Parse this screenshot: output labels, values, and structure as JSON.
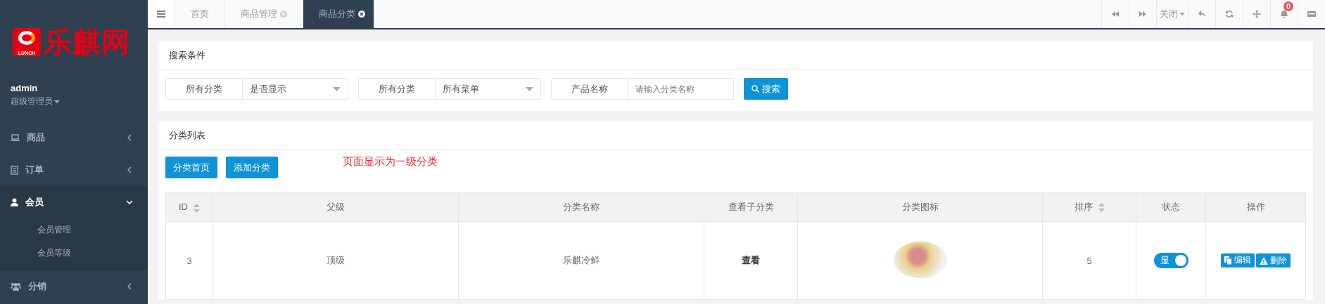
{
  "logo": {
    "mark_text": "LUNCH",
    "name": "乐麒网"
  },
  "user": {
    "name": "admin",
    "role": "超级管理员"
  },
  "sidebar": {
    "items": [
      {
        "label": "商品",
        "expanded": false
      },
      {
        "label": "订单",
        "expanded": false
      },
      {
        "label": "会员",
        "expanded": true,
        "children": [
          {
            "label": "会员管理"
          },
          {
            "label": "会员等级"
          }
        ]
      },
      {
        "label": "分销",
        "expanded": false
      }
    ]
  },
  "tabs": [
    {
      "label": "首页",
      "selected": false,
      "closable": false
    },
    {
      "label": "商品管理",
      "selected": false,
      "closable": true
    },
    {
      "label": "商品分类",
      "selected": true,
      "closable": true
    }
  ],
  "toolbar": {
    "close_menu": "关闭",
    "notifications": "0"
  },
  "search_card": {
    "title": "搜索条件",
    "filters": [
      {
        "kind": "select",
        "label": "所有分类",
        "value": "是否显示"
      },
      {
        "kind": "select",
        "label": "所有分类",
        "value": "所有菜单"
      },
      {
        "kind": "input",
        "label": "产品名称",
        "placeholder": "请输入分类名称"
      }
    ],
    "button": "搜索"
  },
  "list_card": {
    "title": "分类列表",
    "buttons": [
      "分类首页",
      "添加分类"
    ],
    "note": "页面显示为一级分类",
    "table": {
      "columns": [
        {
          "label": "ID",
          "sortable": true
        },
        {
          "label": "父级",
          "sortable": false
        },
        {
          "label": "分类名称",
          "sortable": false
        },
        {
          "label": "查看子分类",
          "sortable": false
        },
        {
          "label": "分类图标",
          "sortable": false
        },
        {
          "label": "排序",
          "sortable": true
        },
        {
          "label": "状态",
          "sortable": false
        },
        {
          "label": "操作",
          "sortable": false
        }
      ],
      "rows": [
        {
          "id": "3",
          "parent": "顶级",
          "name": "乐麒冷鲜",
          "view": "查看",
          "sort": "5",
          "status": {
            "label": "显",
            "on": true
          },
          "actions": [
            "编辑",
            "删除"
          ]
        }
      ]
    }
  }
}
